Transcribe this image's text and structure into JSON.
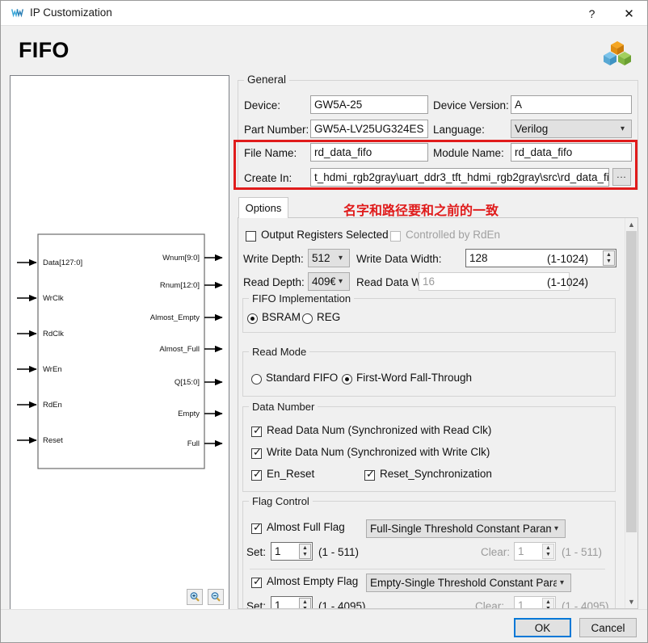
{
  "window": {
    "title": "IP Customization",
    "app_icon": "gowin-logo-icon",
    "help_label": "?",
    "close_label": "✕"
  },
  "header": {
    "title": "FIFO",
    "ip_icon": "ip-cubes-icon"
  },
  "preview": {
    "zoom_in_icon": "zoom-in-icon",
    "zoom_out_icon": "zoom-out-icon",
    "block_name": "FIFO",
    "inputs": [
      "Data[127:0]",
      "WrClk",
      "RdClk",
      "WrEn",
      "RdEn",
      "Reset"
    ],
    "outputs": [
      "Wnum[9:0]",
      "Rnum[12:0]",
      "Almost_Empty",
      "Almost_Full",
      "Q[15:0]",
      "Empty",
      "Full"
    ]
  },
  "general": {
    "legend": "General",
    "device_label": "Device:",
    "device_value": "GW5A-25",
    "device_version_label": "Device Version:",
    "device_version_value": "A",
    "part_number_label": "Part Number:",
    "part_number_value": "GW5A-LV25UG324ES",
    "language_label": "Language:",
    "language_value": "Verilog",
    "file_name_label": "File Name:",
    "file_name_value": "rd_data_fifo",
    "module_name_label": "Module Name:",
    "module_name_value": "rd_data_fifo",
    "create_in_label": "Create In:",
    "create_in_value": "t_hdmi_rgb2gray\\uart_ddr3_tft_hdmi_rgb2gray\\src\\rd_data_fifo",
    "browse_label": "...",
    "highlight_color": "#e01b1b"
  },
  "annotation": {
    "text": "名字和路径要和之前的一致",
    "color": "#e01b1b"
  },
  "tabs": {
    "options_label": "Options"
  },
  "options": {
    "output_registers": {
      "label": "Output Registers Selected",
      "checked": false
    },
    "controlled_by_rden": {
      "label": "Controlled by RdEn",
      "checked": false,
      "disabled": true
    },
    "write_depth_label": "Write Depth:",
    "write_depth_value": "512",
    "write_data_width_label": "Write Data Width:",
    "write_data_width_value": "128",
    "write_data_width_range": "(1-1024)",
    "read_depth_label": "Read Depth:",
    "read_depth_value": "409€",
    "read_data_width_label": "Read Data Width:",
    "read_data_width_value": "16",
    "read_data_width_range": "(1-1024)",
    "fifo_implementation": {
      "legend": "FIFO Implementation",
      "options": [
        "BSRAM",
        "REG"
      ],
      "selected": "BSRAM"
    },
    "read_mode": {
      "legend": "Read Mode",
      "options": [
        "Standard FIFO",
        "First-Word Fall-Through"
      ],
      "selected": "First-Word Fall-Through"
    },
    "data_number": {
      "legend": "Data Number",
      "read_data_num": "Read Data Num (Synchronized with Read Clk)",
      "read_data_num_checked": true,
      "write_data_num": "Write Data Num (Synchronized with Write Clk)",
      "write_data_num_checked": true,
      "en_reset": "En_Reset",
      "en_reset_checked": true,
      "reset_sync": "Reset_Synchronization",
      "reset_sync_checked": true
    },
    "flag_control": {
      "legend": "Flag Control",
      "almost_full_flag_label": "Almost Full Flag",
      "almost_full_flag_checked": true,
      "almost_full_mode": "Full-Single Threshold Constant Parame",
      "full_set_label": "Set:",
      "full_set_value": "1",
      "full_set_range": "(1 - 511)",
      "full_clear_label": "Clear:",
      "full_clear_value": "1",
      "full_clear_range": "(1 - 511)",
      "almost_empty_flag_label": "Almost Empty Flag",
      "almost_empty_flag_checked": true,
      "almost_empty_mode": "Empty-Single Threshold Constant Param",
      "empty_set_label": "Set:",
      "empty_set_value": "1",
      "empty_set_range": "(1 - 4095)",
      "empty_clear_label": "Clear:",
      "empty_clear_value": "1",
      "empty_clear_range": "(1 - 4095)"
    }
  },
  "footer": {
    "ok_label": "OK",
    "cancel_label": "Cancel"
  }
}
